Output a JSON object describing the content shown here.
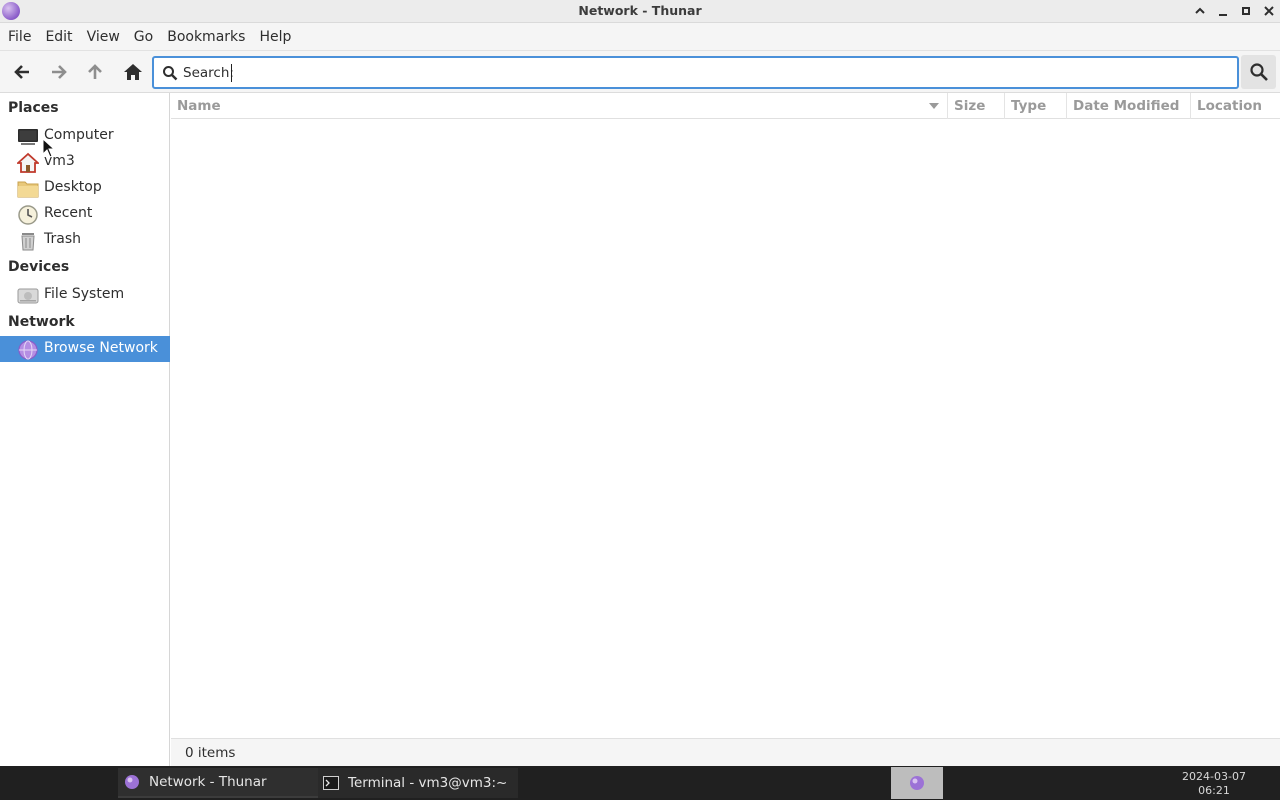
{
  "window": {
    "title": "Network - Thunar"
  },
  "menu": [
    "File",
    "Edit",
    "View",
    "Go",
    "Bookmarks",
    "Help"
  ],
  "toolbar": {
    "search_label": "Search:",
    "search_value": ""
  },
  "sidebar": {
    "places_header": "Places",
    "places": [
      {
        "label": "Computer",
        "icon": "computer-icon"
      },
      {
        "label": "vm3",
        "icon": "home-icon"
      },
      {
        "label": "Desktop",
        "icon": "folder-icon"
      },
      {
        "label": "Recent",
        "icon": "clock-icon"
      },
      {
        "label": "Trash",
        "icon": "trash-icon"
      }
    ],
    "devices_header": "Devices",
    "devices": [
      {
        "label": "File System",
        "icon": "drive-icon"
      }
    ],
    "network_header": "Network",
    "network": [
      {
        "label": "Browse Network",
        "icon": "network-icon",
        "selected": true
      }
    ]
  },
  "columns": [
    "Name",
    "Size",
    "Type",
    "Date Modified",
    "Location"
  ],
  "status": {
    "text": "0 items"
  },
  "taskbar": {
    "tasks": [
      {
        "label": "Network - Thunar",
        "icon": "thunar-icon"
      },
      {
        "label": "Terminal - vm3@vm3:~",
        "icon": "terminal-icon"
      }
    ],
    "clock_date": "2024-03-07",
    "clock_time": "06:21"
  },
  "colors": {
    "accent": "#4a90d9",
    "taskbar_bg": "#202020"
  }
}
